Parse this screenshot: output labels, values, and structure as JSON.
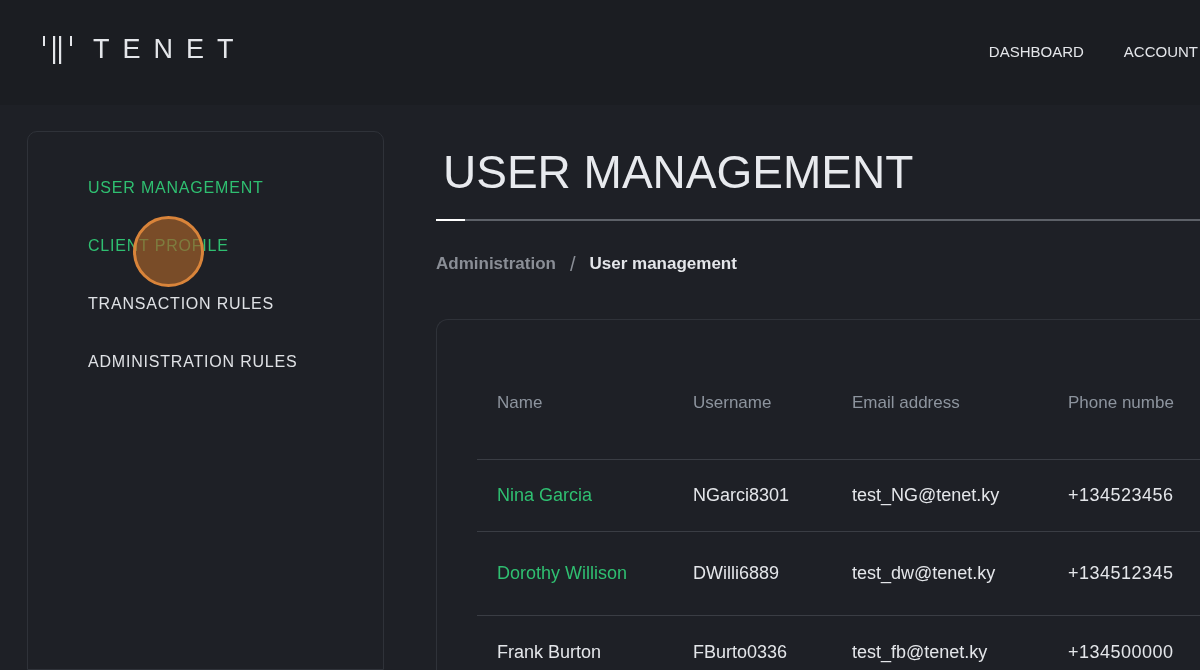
{
  "header": {
    "logo_text": "TENET",
    "nav": [
      {
        "label": "DASHBOARD"
      },
      {
        "label": "ACCOUNT"
      }
    ]
  },
  "sidebar": {
    "items": [
      {
        "label": "USER MANAGEMENT",
        "highlighted": true
      },
      {
        "label": "CLIENT PROFILE",
        "highlighted": true
      },
      {
        "label": "TRANSACTION RULES",
        "highlighted": false
      },
      {
        "label": "ADMINISTRATION RULES",
        "highlighted": false
      }
    ]
  },
  "page": {
    "title": "USER MANAGEMENT",
    "breadcrumb": [
      {
        "label": "Administration",
        "current": false
      },
      {
        "label": "User management",
        "current": true
      }
    ],
    "separator": "/"
  },
  "table": {
    "columns": [
      "Name",
      "Username",
      "Email address",
      "Phone numbe"
    ],
    "rows": [
      {
        "name": "Nina Garcia",
        "linked": true,
        "username": "NGarci8301",
        "email": "test_NG@tenet.ky",
        "phone": "+134523456"
      },
      {
        "name": "Dorothy Willison",
        "linked": true,
        "username": "DWilli6889",
        "email": "test_dw@tenet.ky",
        "phone": "+134512345"
      },
      {
        "name": "Frank Burton",
        "linked": false,
        "username": "FBurto0336",
        "email": "test_fb@tenet.ky",
        "phone": "+134500000"
      }
    ]
  },
  "click_indicator": {
    "visible": true
  }
}
